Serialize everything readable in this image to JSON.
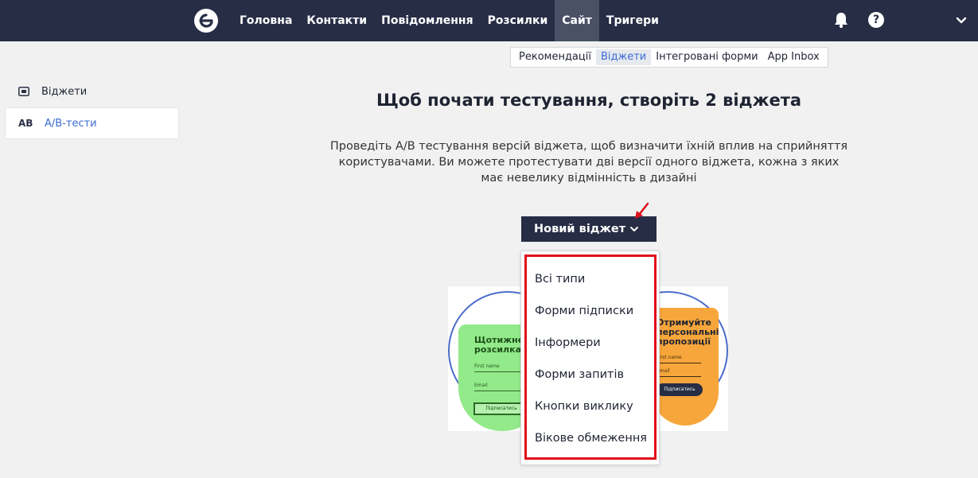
{
  "header": {
    "nav": [
      "Головна",
      "Контакти",
      "Повідомлення",
      "Розсилки",
      "Сайт",
      "Тригери"
    ],
    "active_nav": "Сайт",
    "help_label": "?"
  },
  "subnav": {
    "items": [
      "Рекомендації",
      "Віджети",
      "Інтегровані форми",
      "App Inbox"
    ],
    "active": "Віджети"
  },
  "sidebar": {
    "items": [
      {
        "label": "Віджети",
        "icon": "widget-icon"
      },
      {
        "label": "A/B-тести",
        "icon_text": "AB"
      }
    ]
  },
  "main": {
    "title": "Щоб почати тестування, створіть 2 віджета",
    "description": "Проведіть A/B тестування версій віджета, щоб визначити їхній вплив на сприйняття користувачами. Ви можете протестувати дві версії одного віджета, кожна з яких має невелику відмінність в дизайні",
    "new_widget_button": "Новий віджет"
  },
  "dropdown": {
    "items": [
      "Всі типи",
      "Форми підписки",
      "Інформери",
      "Форми запитів",
      "Кнопки виклику",
      "Вікове обмеження"
    ]
  },
  "illustration": {
    "green_title": "Щотижнева\nрозсилка",
    "green_field_1": "First name",
    "green_field_2": "Email",
    "green_button": "Підписатись",
    "orange_title": "Отримуйте\nперсональні\nпропозиції",
    "orange_field_1": "First name",
    "orange_field_2": "Email",
    "orange_button": "Підписатись"
  },
  "colors": {
    "navbar": "#272d45",
    "accent_blue": "#3b6bd4",
    "highlight_red": "#e0101a",
    "green_card": "#93ea8a",
    "orange_card": "#f7a63b"
  }
}
